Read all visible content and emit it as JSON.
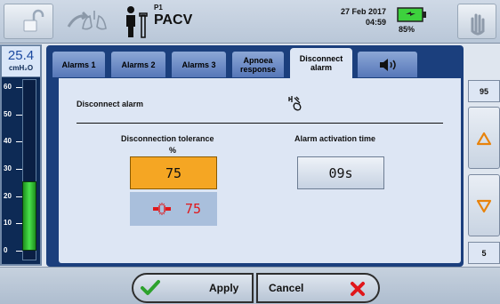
{
  "header": {
    "patient_id": "P1",
    "mode": "PACV",
    "date": "27 Feb 2017",
    "time": "04:59",
    "battery": "85%"
  },
  "gauge": {
    "value": "25.4",
    "unit": "cmH₂O",
    "ticks": [
      "60",
      "50",
      "40",
      "30",
      "20",
      "10",
      "0"
    ],
    "level_cmh2o": 25.4
  },
  "tabs": [
    {
      "label": "Alarms 1"
    },
    {
      "label": "Alarms 2"
    },
    {
      "label": "Alarms 3"
    },
    {
      "label": "Apnoea response"
    },
    {
      "label": "Disconnect alarm"
    }
  ],
  "active_tab": "Disconnect alarm",
  "content": {
    "section_title": "Disconnect alarm",
    "tolerance_label": "Disconnection tolerance",
    "tolerance_unit": "%",
    "tolerance_value": "75",
    "tolerance_current": "75",
    "activation_label": "Alarm activation time",
    "activation_value": "09s"
  },
  "right": {
    "max": "95",
    "min": "5"
  },
  "footer": {
    "apply_label": "Apply",
    "cancel_label": "Cancel"
  },
  "colors": {
    "accent_orange": "#f5a623",
    "panel_blue": "#1b3f7d",
    "battery_green": "#3dd13d",
    "alarm_red": "#e0171b"
  }
}
